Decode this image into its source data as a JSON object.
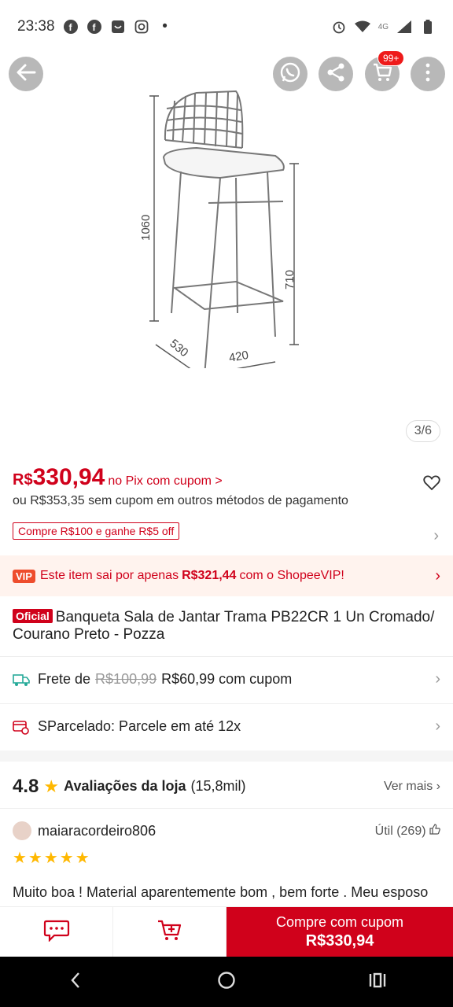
{
  "status_bar": {
    "time": "23:38",
    "network": "4G"
  },
  "hero": {
    "page_indicator": "3/6",
    "cart_badge": "99+",
    "dim_height": "1060",
    "dim_seat": "710",
    "dim_depth": "530",
    "dim_width": "420"
  },
  "price": {
    "currency": "R$",
    "value": "330,94",
    "note": "no Pix com cupom >",
    "alt": "ou R$353,35 sem cupom em outros métodos de pagamento",
    "voucher": "Compre R$100 e ganhe R$5 off"
  },
  "vip": {
    "badge": "VIP",
    "prefix": "Este item sai por apenas",
    "price": "R$321,44",
    "suffix": "com o ShopeeVIP!"
  },
  "product": {
    "badge": "Oficial",
    "title": "Banqueta Sala de Jantar Trama PB22CR 1 Un Cromado/ Courano Preto - Pozza"
  },
  "shipping": {
    "label": "Frete de",
    "old_price": "R$100,99",
    "new_price": "R$60,99 com cupom"
  },
  "installments": {
    "label": "SParcelado: Parcele em até 12x"
  },
  "store_rating": {
    "score": "4.8",
    "label": "Avaliações da loja",
    "count": "(15,8mil)",
    "more": "Ver mais"
  },
  "review": {
    "user": "maiaracordeiro806",
    "useful": "Útil (269)",
    "stars": "★★★★★",
    "text": "Muito boa ! Material aparentemente bom , bem forte . Meu esposo quem montou , e não teve muita dificuldade"
  },
  "bottom": {
    "buy_line1": "Compre com cupom",
    "buy_line2": "R$330,94"
  },
  "colors": {
    "accent": "#d0011b",
    "vip_bg": "#fff3ee",
    "star": "#ffb800"
  }
}
